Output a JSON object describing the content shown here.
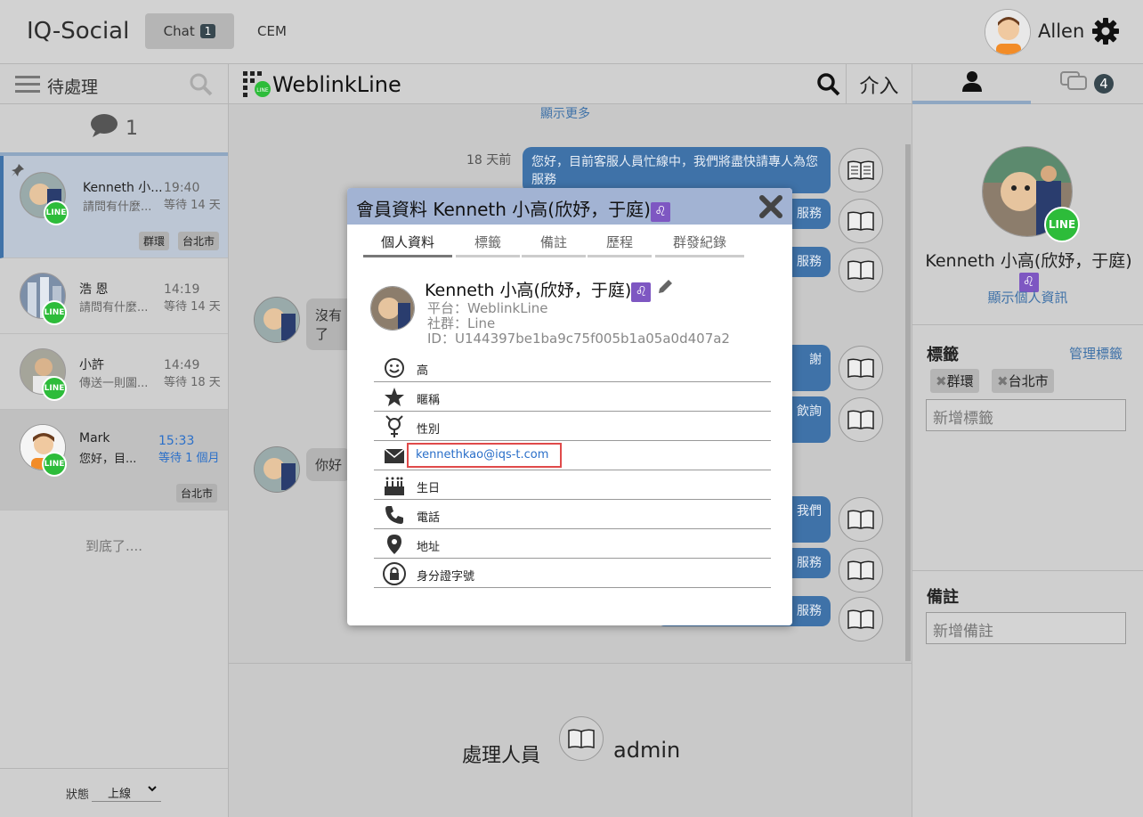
{
  "app": {
    "title": "IQ-Social"
  },
  "nav": {
    "chat_label": "Chat",
    "chat_count": "1",
    "cem_label": "CEM"
  },
  "user": {
    "name": "Allen"
  },
  "left": {
    "header_label": "待處理",
    "unread_count": "1",
    "conversations": [
      {
        "name": "Kenneth 小...",
        "preview": "請問有什麼...",
        "time": "19:40",
        "wait": "等待 14 天",
        "tags": [
          "群環",
          "台北市"
        ]
      },
      {
        "name": "浩 恩",
        "preview": "請問有什麼...",
        "time": "14:19",
        "wait": "等待 14 天",
        "tags": []
      },
      {
        "name": "小許",
        "preview": "傳送一則圖...",
        "time": "14:49",
        "wait": "等待 18 天",
        "tags": []
      },
      {
        "name": "Mark",
        "preview": "您好，目...",
        "time": "15:33",
        "wait": "等待 1 個月",
        "tags": [
          "台北市"
        ]
      }
    ],
    "end_text": "到底了....",
    "status_label": "狀態",
    "status_value": "上線"
  },
  "middle": {
    "channel": "WeblinkLine",
    "intervene": "介入",
    "show_more": "顯示更多",
    "date_label": "18 天前",
    "bubble_1": "您好，目前客服人員忙線中，我們將盡快請專人為您服務",
    "bubble_2": "服務",
    "bubble_3": "服務",
    "bubble_4": "謝",
    "bubble_5": "飲詢",
    "bubble_6": "我們",
    "bubble_7": "服務",
    "bubble_8": "服務",
    "left_bubble_1": "沒有了",
    "left_bubble_2": "你好",
    "handler_label": "處理人員",
    "handler_name": "admin"
  },
  "right": {
    "tab_count": "4",
    "contact_name": "Kenneth 小高(欣妤，于庭)",
    "zodiac": "♌",
    "show_profile": "顯示個人資訊",
    "tags_title": "標籤",
    "manage_tags": "管理標籤",
    "tags": [
      "群環",
      "台北市"
    ],
    "add_tag_placeholder": "新增標籤",
    "notes_title": "備註",
    "add_note_placeholder": "新增備註"
  },
  "modal": {
    "title": "會員資料 Kenneth 小高(欣妤，于庭)",
    "zodiac": "♌",
    "tabs": [
      "個人資料",
      "標籤",
      "備註",
      "歷程",
      "群發紀錄"
    ],
    "name": "Kenneth 小高(欣妤，于庭)",
    "platform": "平台：WeblinkLine",
    "community": "社群：Line",
    "id": "ID：U144397be1ba9c75f005b1a05a0d407a2",
    "fields": {
      "name": "高",
      "nickname": "暱稱",
      "gender": "性別",
      "email": "kennethkao@iqs-t.com",
      "birthday": "生日",
      "phone": "電話",
      "address": "地址",
      "id_number": "身分證字號"
    }
  },
  "colors": {
    "accent": "#3f72a8",
    "line_green": "#2dbc3a",
    "modal_header": "#a2b3d3",
    "highlight": "#e04a4a"
  }
}
